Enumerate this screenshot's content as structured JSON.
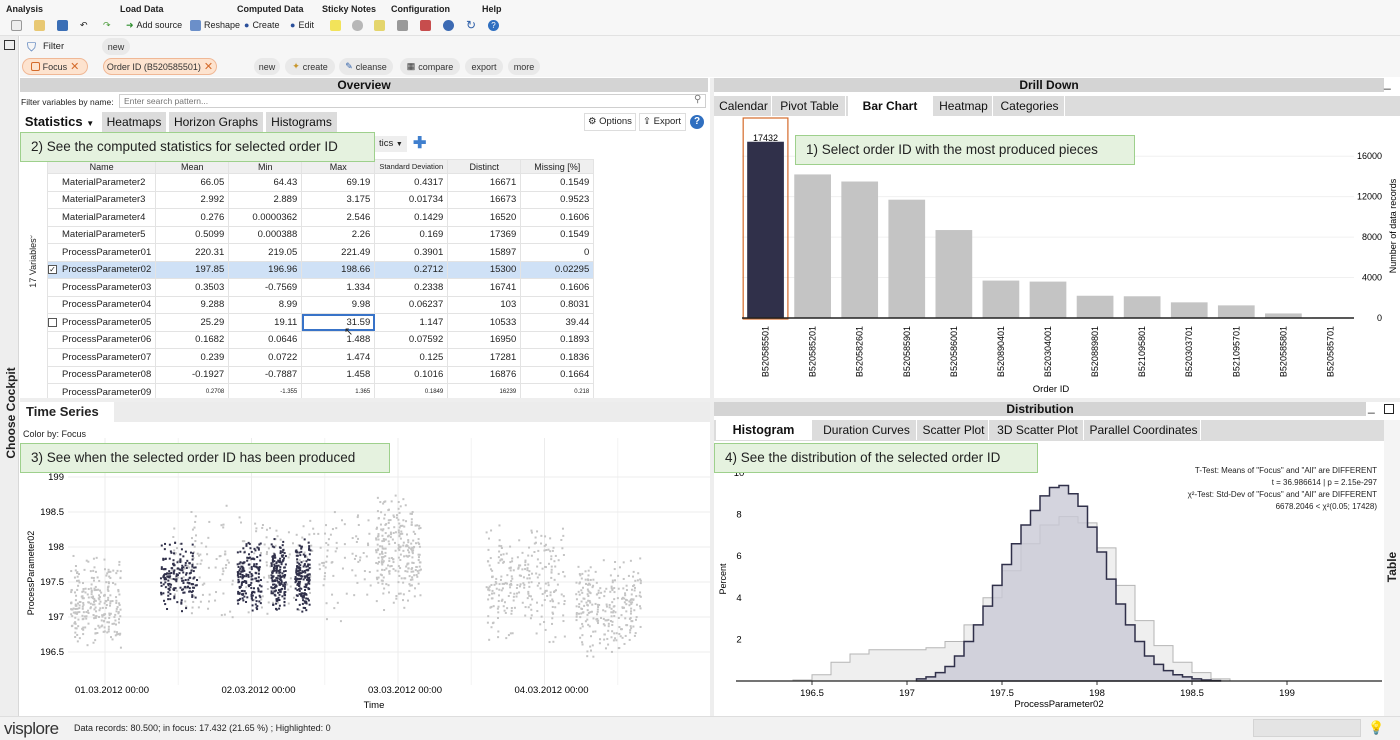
{
  "menu": {
    "groups": [
      "Analysis",
      "Load Data",
      "Computed Data",
      "Sticky Notes",
      "Configuration",
      "Help"
    ],
    "buttons": {
      "add_source": "Add source",
      "reshape": "Reshape",
      "create": "Create",
      "edit": "Edit"
    }
  },
  "cockpit_label": "Choose Cockpit",
  "filter": {
    "label": "Filter",
    "new": "new",
    "chips": {
      "focus": "Focus",
      "order": "Order ID (B520585501)"
    },
    "actions": {
      "new": "new",
      "create": "create",
      "cleanse": "cleanse",
      "compare": "compare",
      "export": "export",
      "more": "more"
    }
  },
  "overview": {
    "title": "Overview",
    "filter_label": "Filter variables by name:",
    "search_placeholder": "Enter search pattern...",
    "tabs": {
      "statistics": "Statistics",
      "heatmaps": "Heatmaps",
      "horizon": "Horizon Graphs",
      "histograms": "Histograms"
    },
    "options": "Options",
    "export": "Export",
    "stat_dropdown": "tics",
    "vars_label": "17 Variables",
    "columns": [
      "Name",
      "Mean",
      "Min",
      "Max",
      "Standard Deviation",
      "Distinct",
      "Missing [%]"
    ],
    "rows": [
      [
        "MaterialParameter2",
        "66.05",
        "64.43",
        "69.19",
        "0.4317",
        "16671",
        "0.1549"
      ],
      [
        "MaterialParameter3",
        "2.992",
        "2.889",
        "3.175",
        "0.01734",
        "16673",
        "0.9523"
      ],
      [
        "MaterialParameter4",
        "0.276",
        "0.0000362",
        "2.546",
        "0.1429",
        "16520",
        "0.1606"
      ],
      [
        "MaterialParameter5",
        "0.5099",
        "0.000388",
        "2.26",
        "0.169",
        "17369",
        "0.1549"
      ],
      [
        "ProcessParameter01",
        "220.31",
        "219.05",
        "221.49",
        "0.3901",
        "15897",
        "0"
      ],
      [
        "ProcessParameter02",
        "197.85",
        "196.96",
        "198.66",
        "0.2712",
        "15300",
        "0.02295"
      ],
      [
        "ProcessParameter03",
        "0.3503",
        "-0.7569",
        "1.334",
        "0.2338",
        "16741",
        "0.1606"
      ],
      [
        "ProcessParameter04",
        "9.288",
        "8.99",
        "9.98",
        "0.06237",
        "103",
        "0.8031"
      ],
      [
        "ProcessParameter05",
        "25.29",
        "19.11",
        "31.59",
        "1.147",
        "10533",
        "39.44"
      ],
      [
        "ProcessParameter06",
        "0.1682",
        "0.0646",
        "1.488",
        "0.07592",
        "16950",
        "0.1893"
      ],
      [
        "ProcessParameter07",
        "0.239",
        "0.0722",
        "1.474",
        "0.125",
        "17281",
        "0.1836"
      ],
      [
        "ProcessParameter08",
        "-0.1927",
        "-0.7887",
        "1.458",
        "0.1016",
        "16876",
        "0.1664"
      ],
      [
        "ProcessParameter09",
        "0.2708",
        "-1.355",
        "1.365",
        "0.1849",
        "16239",
        "0.218"
      ]
    ]
  },
  "drill": {
    "title": "Drill Down",
    "tabs": [
      "Calendar",
      "Pivot Table",
      "Bar Chart",
      "Heatmap",
      "Categories"
    ]
  },
  "timeseries": {
    "title": "Time Series",
    "color_by": "Color by: Focus"
  },
  "distribution": {
    "title": "Distribution",
    "tabs": [
      "Histogram",
      "Duration Curves",
      "Scatter Plot",
      "3D Scatter Plot",
      "Parallel Coordinates"
    ],
    "side_tab": "Table",
    "stats": [
      "T-Test: Means of \"Focus\" and \"All\" are DIFFERENT",
      "t = 36.986614 | p = 2.15e-297",
      "χ²-Test: Std-Dev of \"Focus\" and \"All\" are DIFFERENT",
      "6678.2046 < χ²(0.05; 17428)"
    ]
  },
  "callouts": {
    "c1": "1) Select order ID with the most produced pieces",
    "c2": "2) See the computed statistics for selected order ID",
    "c3": "3) See when the selected order ID has been produced",
    "c4": "4) See the distribution of the selected order ID"
  },
  "status": {
    "logo": "visplore",
    "text": "Data records: 80.500; in focus: 17.432 (21.65 %) ; Highlighted: 0"
  },
  "colors": {
    "focus": "#30304a",
    "context": "#c4c4c4",
    "accent": "#d46a2a",
    "callout_bg": "#e5f2df"
  },
  "chart_data": [
    {
      "type": "bar",
      "xlabel": "Order ID",
      "ylabel": "Number of data records",
      "ylim": [
        0,
        18000
      ],
      "ticks": [
        "0",
        "4000",
        "8000",
        "12000",
        "16000"
      ],
      "tick_values": [
        0,
        4000,
        8000,
        12000,
        16000
      ],
      "categories": [
        "B520585501",
        "B520585201",
        "B520582601",
        "B520585901",
        "B520586001",
        "B520890401",
        "B520304001",
        "B520889801",
        "B521095801",
        "B520303701",
        "B521095701",
        "B520585801",
        "B520585701"
      ],
      "values": [
        17432,
        14200,
        13500,
        11700,
        8700,
        3700,
        3600,
        2200,
        2150,
        1550,
        1250,
        450,
        60
      ],
      "data_labels": [
        "17432"
      ]
    },
    {
      "type": "scatter",
      "xlabel": "Time",
      "ylabel": "ProcessParameter02",
      "ylim": [
        196.2,
        199.1
      ],
      "y_ticks": [
        "196.5",
        "197",
        "197.5",
        "198",
        "198.5",
        "199"
      ],
      "y_tick_values": [
        196.5,
        197,
        197.5,
        198,
        198.5,
        199
      ],
      "x_ticks": [
        "01.03.2012 00:00",
        "02.03.2012 00:00",
        "03.03.2012 00:00",
        "04.03.2012 00:00"
      ],
      "series": [
        {
          "name": "Focus",
          "segments": [
            [
              "2012-03-01 09:00",
              "2012-03-01 15:00"
            ],
            [
              "2012-03-01 21:30",
              "2012-03-02 01:30"
            ],
            [
              "2012-03-02 03:00",
              "2012-03-02 05:30"
            ],
            [
              "2012-03-02 07:00",
              "2012-03-02 09:30"
            ]
          ]
        }
      ]
    },
    {
      "type": "area",
      "xlabel": "ProcessParameter02",
      "ylabel": "Percent",
      "ylim": [
        0,
        10
      ],
      "x_ticks": [
        "196.5",
        "197",
        "197.5",
        "198",
        "198.5",
        "199"
      ],
      "x_tick_values": [
        196.5,
        197,
        197.5,
        198,
        198.5,
        199
      ],
      "y_ticks": [
        "2",
        "4",
        "6",
        "8",
        "10"
      ],
      "y_tick_values": [
        2,
        4,
        6,
        8,
        10
      ],
      "series": [
        {
          "name": "Focus",
          "x": [
            197.05,
            197.1,
            197.15,
            197.2,
            197.25,
            197.3,
            197.35,
            197.4,
            197.45,
            197.5,
            197.55,
            197.6,
            197.65,
            197.7,
            197.75,
            197.8,
            197.85,
            197.9,
            197.95,
            198,
            198.05,
            198.1,
            198.15,
            198.2,
            198.25,
            198.3,
            198.35,
            198.4,
            198.45,
            198.5,
            198.55,
            198.6
          ],
          "values": [
            0.1,
            0.2,
            0.4,
            0.7,
            1.2,
            1.9,
            2.7,
            3.6,
            4.6,
            5.6,
            6.6,
            7.5,
            8.2,
            8.9,
            9.3,
            9.4,
            9.0,
            8.4,
            7.4,
            6.2,
            4.9,
            3.7,
            2.7,
            1.9,
            1.2,
            0.8,
            0.5,
            0.3,
            0.2,
            0.1,
            0.05,
            0.02
          ]
        },
        {
          "name": "All",
          "x": [
            196.4,
            196.5,
            196.6,
            196.7,
            196.8,
            196.9,
            197,
            197.1,
            197.2,
            197.3,
            197.4,
            197.5,
            197.6,
            197.7,
            197.8,
            197.9,
            198,
            198.1,
            198.2,
            198.3,
            198.4,
            198.5,
            198.6
          ],
          "values": [
            0.05,
            0.3,
            0.9,
            1.3,
            1.5,
            1.5,
            1.5,
            1.6,
            1.9,
            2.7,
            4.0,
            5.3,
            6.6,
            7.5,
            7.9,
            7.6,
            6.4,
            4.6,
            2.9,
            1.7,
            0.9,
            0.4,
            0.1
          ]
        }
      ]
    }
  ]
}
